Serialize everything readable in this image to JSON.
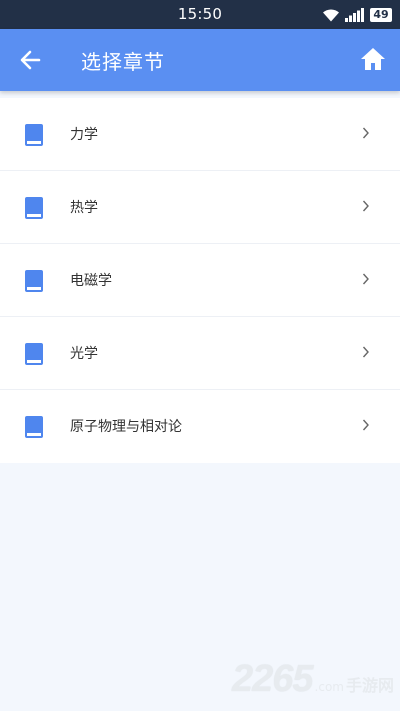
{
  "status_bar": {
    "time": "15:50",
    "battery": "49",
    "icons": [
      "wifi-icon",
      "signal-icon",
      "battery-icon"
    ]
  },
  "app_bar": {
    "title": "选择章节",
    "back_icon": "arrow-left-icon",
    "home_icon": "home-icon",
    "color": "#5a8ff2"
  },
  "chapters": [
    {
      "label": "力学",
      "icon": "book-icon"
    },
    {
      "label": "热学",
      "icon": "book-icon"
    },
    {
      "label": "电磁学",
      "icon": "book-icon"
    },
    {
      "label": "光学",
      "icon": "book-icon"
    },
    {
      "label": "原子物理与相对论",
      "icon": "book-icon"
    }
  ],
  "watermark": {
    "number": "2265",
    "site": "手游网",
    "domain": ".com"
  }
}
